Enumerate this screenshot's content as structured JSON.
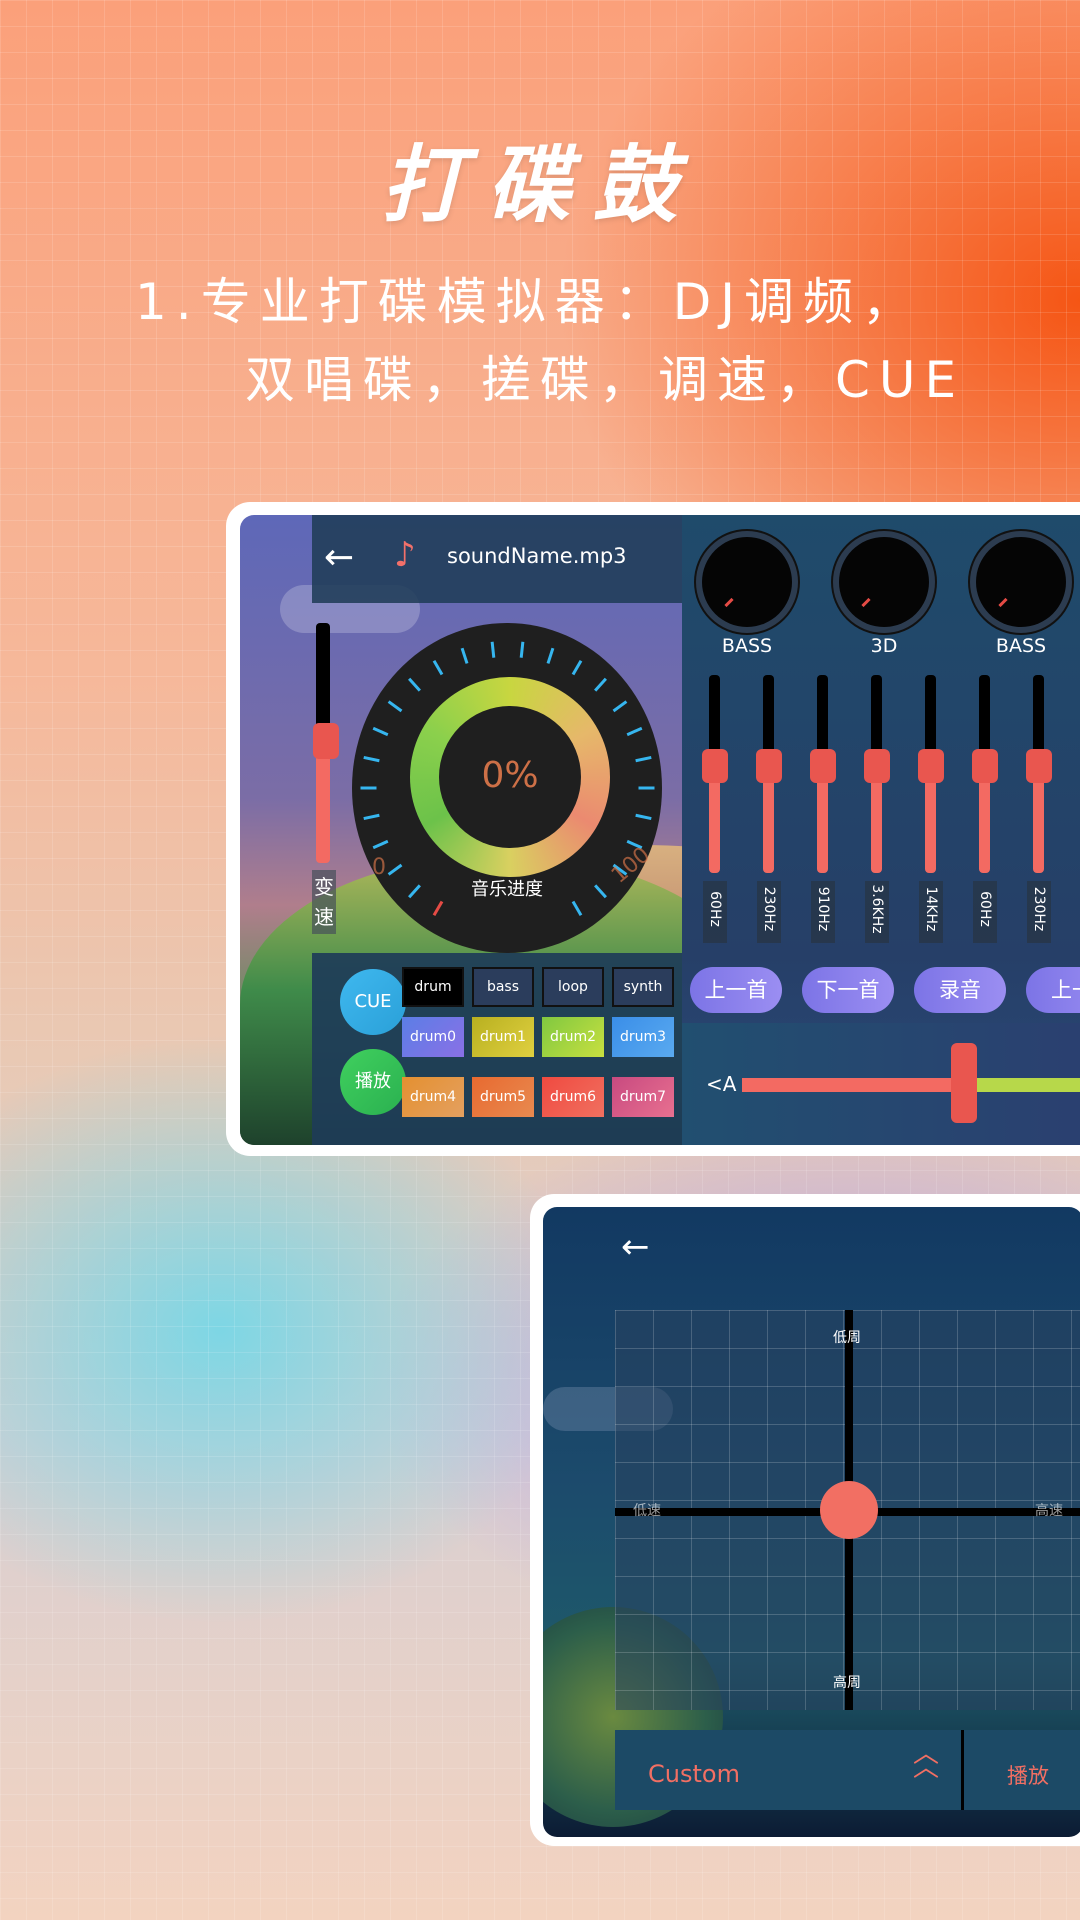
{
  "headline": {
    "title": "打碟鼓",
    "line1": "1.专业打碟模拟器：DJ调频，",
    "line2": "双唱碟，搓碟，调速，CUE"
  },
  "screen1": {
    "file_name": "soundName.mp3",
    "back_icon": "back-arrow-icon",
    "music_icon": "add-music-icon",
    "speed_label": "变速",
    "progress_percent": "0%",
    "progress_label": "音乐进度",
    "dial_min": "0",
    "dial_max": "100",
    "knob_labels": [
      "BASS",
      "3D",
      "BASS"
    ],
    "eq_bands": [
      "60Hz",
      "230Hz",
      "910Hz",
      "3.6KHz",
      "14KHz",
      "60Hz",
      "230Hz"
    ],
    "eq_levels": [
      0.4,
      0.4,
      0.4,
      0.4,
      0.4,
      0.4,
      0.4
    ],
    "buttons": [
      "上一首",
      "下一首",
      "录音",
      "上一"
    ],
    "crossfader_label": "<A",
    "crossfader_level": 0.62,
    "cue_label": "CUE",
    "play_label": "播放",
    "pad_top": [
      "drum",
      "bass",
      "loop",
      "synth"
    ],
    "pads": [
      "drum0",
      "drum1",
      "drum2",
      "drum3",
      "drum4",
      "drum5",
      "drum6",
      "drum7"
    ]
  },
  "screen2": {
    "back_icon": "back-arrow-icon",
    "axis_top": "低周",
    "axis_bottom": "高周",
    "axis_left": "低速",
    "axis_right": "高速",
    "preset": "Custom",
    "chevron_icon": "double-chevron-up-icon",
    "play_label": "播放"
  },
  "colors": {
    "accent": "#f26f63",
    "pill": "#8b80ec",
    "tick": "#36b6ef"
  }
}
